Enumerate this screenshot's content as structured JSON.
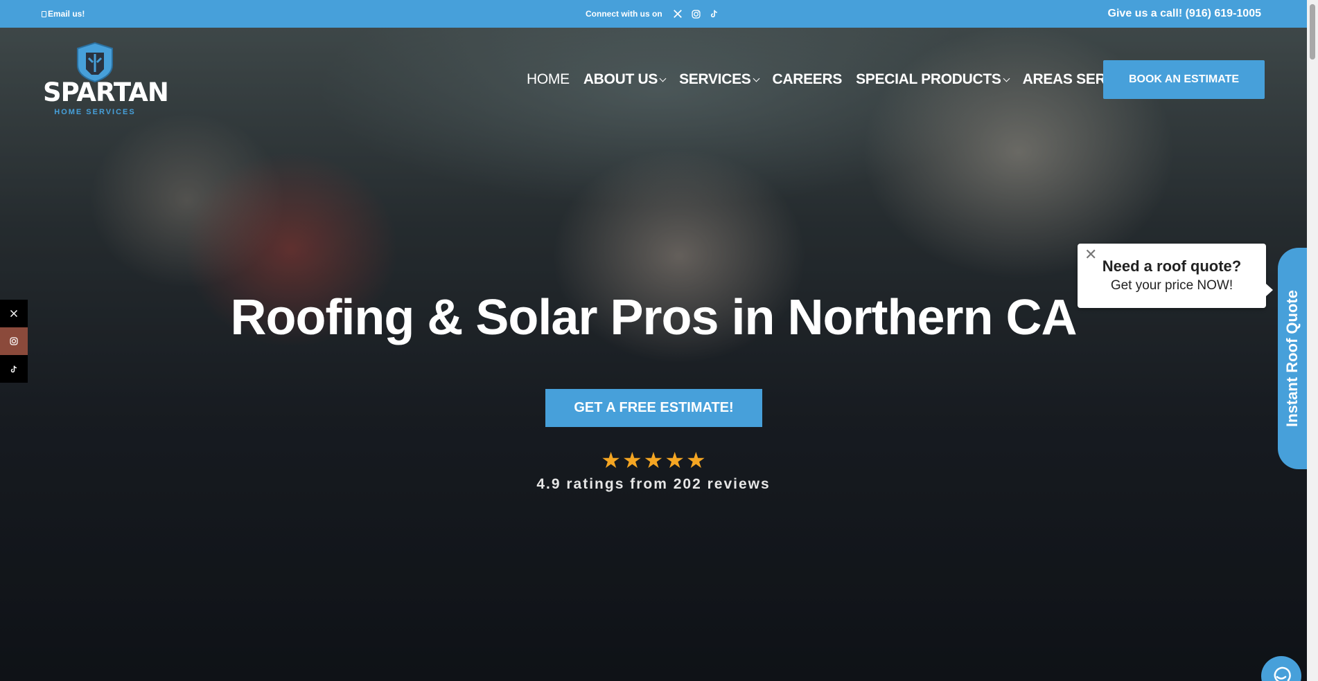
{
  "topbar": {
    "email_label": "Email us!",
    "connect_label": "Connect with us on",
    "socials": [
      "x-icon",
      "instagram-icon",
      "tiktok-icon"
    ],
    "phone_label": "Give us a call! (916) 619-1005"
  },
  "logo": {
    "name": "SPARTAN",
    "tagline": "HOME SERVICES"
  },
  "nav": {
    "items": [
      {
        "label": "HOME"
      },
      {
        "label": "ABOUT US"
      },
      {
        "label": "SERVICES"
      },
      {
        "label": "CAREERS"
      },
      {
        "label": "SPECIAL PRODUCTS"
      },
      {
        "label": "AREAS SERVED"
      }
    ],
    "book_label": "BOOK AN ESTIMATE"
  },
  "hero": {
    "headline": "Roofing & Solar Pros in Northern CA",
    "cta_label": "GET A FREE ESTIMATE!",
    "stars": 5,
    "rating_text": "4.9 ratings from 202 reviews"
  },
  "quote_popup": {
    "title": "Need a roof quote?",
    "subtitle": "Get your price NOW!"
  },
  "side_tab": {
    "label": "Instant Roof Quote"
  },
  "colors": {
    "brand_blue": "#47a0da",
    "star": "#f5a623"
  }
}
